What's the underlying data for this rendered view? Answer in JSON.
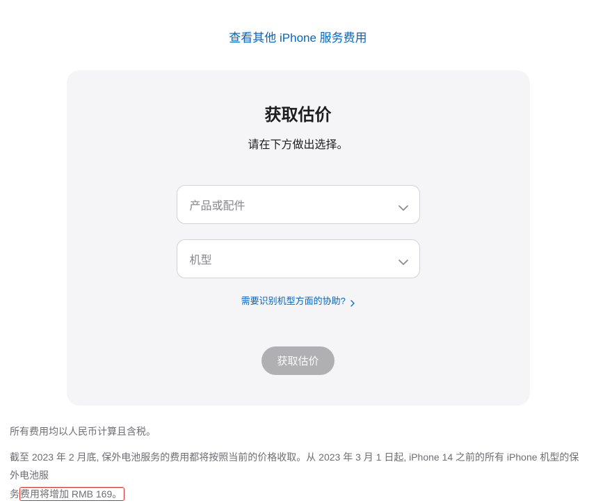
{
  "top_link": "查看其他 iPhone 服务费用",
  "card": {
    "title": "获取估价",
    "subtitle": "请在下方做出选择。",
    "select_product_placeholder": "产品或配件",
    "select_model_placeholder": "机型",
    "help_link": "需要识别机型方面的协助?",
    "submit_button": "获取估价"
  },
  "footer": {
    "line1": "所有费用均以人民币计算且含税。",
    "line2_part1": "截至 2023 年 2 月底, 保外电池服务的费用都将按照当前的价格收取。从 2023 年 3 月 1 日起, iPhone 14 之前的所有 iPhone 机型的保外电池服",
    "line2_part2_prefix": "务",
    "line2_highlight": "费用将增加 RMB 169。"
  }
}
